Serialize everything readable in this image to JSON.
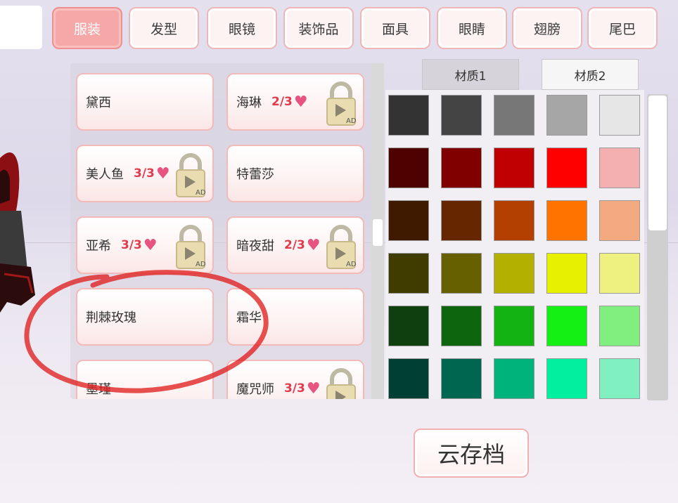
{
  "tabs": [
    {
      "label": "服装",
      "active": true
    },
    {
      "label": "发型",
      "active": false
    },
    {
      "label": "眼镜",
      "active": false
    },
    {
      "label": "装饰品",
      "active": false
    },
    {
      "label": "面具",
      "active": false
    },
    {
      "label": "眼睛",
      "active": false
    },
    {
      "label": "翅膀",
      "active": false
    },
    {
      "label": "尾巴",
      "active": false
    }
  ],
  "items": [
    {
      "name": "黛西",
      "progress": "",
      "locked": false
    },
    {
      "name": "海琳",
      "progress": "2/3",
      "locked": true
    },
    {
      "name": "美人鱼",
      "progress": "3/3",
      "locked": true
    },
    {
      "name": "特蕾莎",
      "progress": "",
      "locked": false
    },
    {
      "name": "亚希",
      "progress": "3/3",
      "locked": true
    },
    {
      "name": "暗夜甜",
      "progress": "2/3",
      "locked": true
    },
    {
      "name": "荆棘玫瑰",
      "progress": "",
      "locked": false
    },
    {
      "name": "霜华",
      "progress": "",
      "locked": false
    },
    {
      "name": "墨瑾",
      "progress": "",
      "locked": false
    },
    {
      "name": "魔咒师",
      "progress": "3/3",
      "locked": true
    }
  ],
  "lock_badge": "AD",
  "material_tabs": [
    "材质1",
    "材质2"
  ],
  "material_selected": "材质2",
  "swatches": [
    [
      "#333333",
      "#444444",
      "#777777",
      "#a6a6a6",
      "#e6e6e6"
    ],
    [
      "#4f0000",
      "#800000",
      "#c00000",
      "#ff0000",
      "#f4b0b0"
    ],
    [
      "#3f1a00",
      "#662600",
      "#b34000",
      "#ff7300",
      "#f4aa80"
    ],
    [
      "#403c00",
      "#666000",
      "#b3b000",
      "#e6f000",
      "#eef080"
    ],
    [
      "#0f3f0f",
      "#0d660d",
      "#14b314",
      "#14ef14",
      "#80ef80"
    ],
    [
      "#003f33",
      "#00664f",
      "#00b37a",
      "#00f0a0",
      "#80f0c0"
    ]
  ],
  "cloud_save": "云存档",
  "colors": {
    "accent": "#f6a7a7",
    "progress": "#e23b4e",
    "heart": "#e75480",
    "annotation": "#e02020"
  }
}
